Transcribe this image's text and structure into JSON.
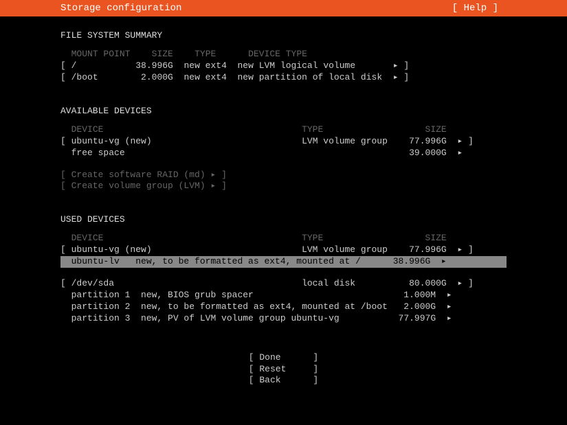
{
  "header": {
    "title": "Storage configuration",
    "help": "[ Help ]"
  },
  "fileSystemSummary": {
    "title": "FILE SYSTEM SUMMARY",
    "headers": {
      "mountPoint": "MOUNT POINT",
      "size": "SIZE",
      "type": "TYPE",
      "deviceType": "DEVICE TYPE"
    },
    "rows": [
      {
        "mount": "/",
        "size": "38.996G",
        "type": "new ext4",
        "deviceType": "new LVM logical volume",
        "arrow": "▸ ]"
      },
      {
        "mount": "/boot",
        "size": "2.000G",
        "type": "new ext4",
        "deviceType": "new partition of local disk",
        "arrow": "▸ ]"
      }
    ]
  },
  "availableDevices": {
    "title": "AVAILABLE DEVICES",
    "headers": {
      "device": "DEVICE",
      "type": "TYPE",
      "size": "SIZE"
    },
    "rows": [
      {
        "device": "ubuntu-vg (new)",
        "type": "LVM volume group",
        "size": "77.996G",
        "arrow": "▸ ]",
        "bracket": "["
      },
      {
        "device": "free space",
        "type": "",
        "size": "39.000G",
        "arrow": "▸",
        "bracket": " "
      }
    ],
    "actions": [
      "[ Create software RAID (md) ▸ ]",
      "[ Create volume group (LVM) ▸ ]"
    ]
  },
  "usedDevices": {
    "title": "USED DEVICES",
    "headers": {
      "device": "DEVICE",
      "type": "TYPE",
      "size": "SIZE"
    },
    "group1": [
      {
        "prefix": "[ ",
        "device": "ubuntu-vg (new)",
        "type": "LVM volume group",
        "size": "77.996G",
        "arrow": "▸ ]",
        "highlight": false
      },
      {
        "prefix": "  ",
        "device": "ubuntu-lv   new, to be formatted as ext4, mounted at /",
        "type": "",
        "size": "38.996G",
        "arrow": "▸  ",
        "highlight": true
      }
    ],
    "group2": [
      {
        "prefix": "[ ",
        "device": "/dev/sda",
        "desc": "",
        "type": "local disk",
        "size": "80.000G",
        "arrow": "▸ ]"
      },
      {
        "prefix": "  ",
        "device": "partition 1  new, BIOS grub spacer",
        "type": "",
        "size": "1.000M",
        "arrow": "▸  "
      },
      {
        "prefix": "  ",
        "device": "partition 2  new, to be formatted as ext4, mounted at /boot",
        "type": "",
        "size": "2.000G",
        "arrow": "▸  "
      },
      {
        "prefix": "  ",
        "device": "partition 3  new, PV of LVM volume group ubuntu-vg",
        "type": "",
        "size": "77.997G",
        "arrow": "▸  "
      }
    ]
  },
  "buttons": {
    "done": "[ Done      ]",
    "reset": "[ Reset     ]",
    "back": "[ Back      ]"
  }
}
